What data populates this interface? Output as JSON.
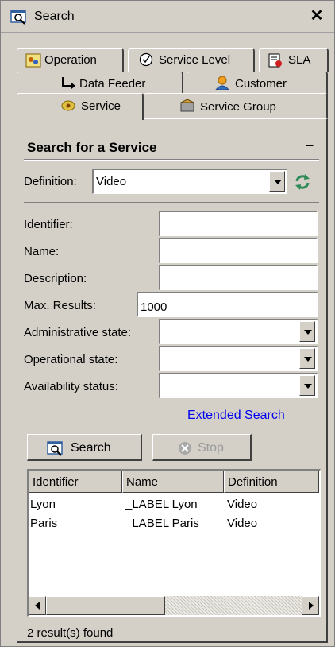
{
  "window": {
    "title": "Search",
    "close_label": "✕"
  },
  "tabs": {
    "row1": [
      {
        "label": "Operation",
        "icon": "operation-icon"
      },
      {
        "label": "Service Level",
        "icon": "service-level-icon"
      },
      {
        "label": "SLA",
        "icon": "sla-icon"
      }
    ],
    "row2": [
      {
        "label": "Data Feeder",
        "icon": "data-feeder-icon"
      },
      {
        "label": "Customer",
        "icon": "customer-icon"
      }
    ],
    "row3": [
      {
        "label": "Service",
        "icon": "service-icon",
        "active": true
      },
      {
        "label": "Service Group",
        "icon": "service-group-icon"
      }
    ]
  },
  "search": {
    "title": "Search for a Service",
    "collapse_label": "–",
    "definition_label": "Definition:",
    "definition_value": "Video",
    "fields": {
      "identifier_label": "Identifier:",
      "identifier_value": "",
      "name_label": "Name:",
      "name_value": "",
      "description_label": "Description:",
      "description_value": "",
      "max_results_label": "Max. Results:",
      "max_results_value": "1000",
      "admin_state_label": "Administrative state:",
      "admin_state_value": "",
      "oper_state_label": "Operational state:",
      "oper_state_value": "",
      "availability_label": "Availability status:",
      "availability_value": ""
    },
    "extended_search_label": "Extended Search",
    "search_button_label": "Search",
    "stop_button_label": "Stop"
  },
  "results": {
    "columns": [
      "Identifier",
      "Name",
      "Definition"
    ],
    "rows": [
      {
        "identifier": "Lyon",
        "name": "_LABEL Lyon",
        "definition": "Video"
      },
      {
        "identifier": "Paris",
        "name": "_LABEL Paris",
        "definition": "Video"
      }
    ],
    "status": "2 result(s) found"
  },
  "colors": {
    "link": "#0000ee",
    "background": "#d4d0c8",
    "refresh": "#2e8b57"
  }
}
